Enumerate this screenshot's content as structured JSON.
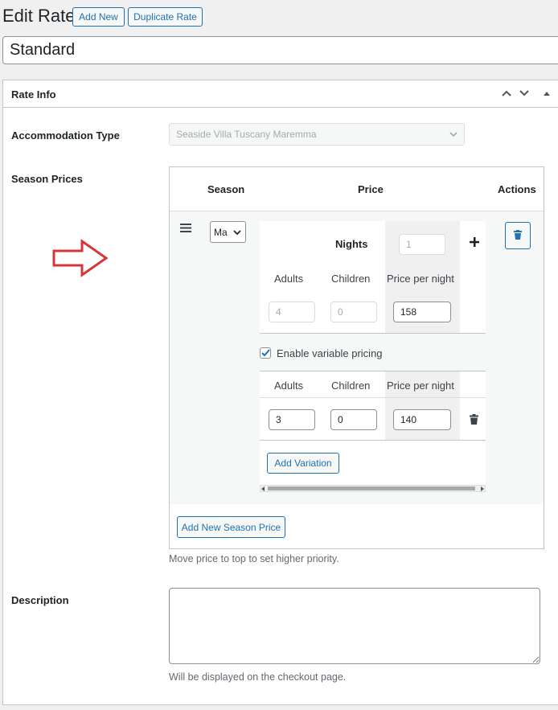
{
  "header": {
    "title": "Edit Rate",
    "add_new_label": "Add New",
    "duplicate_label": "Duplicate Rate",
    "rate_title_value": "Standard"
  },
  "rate_info": {
    "title": "Rate Info",
    "accommodation_label": "Accommodation Type",
    "accommodation_value": "Seaside Villa Tuscany Maremma",
    "season_prices_label": "Season Prices",
    "table": {
      "col_season": "Season",
      "col_price": "Price",
      "col_actions": "Actions",
      "season_value": "Ma",
      "nights_label": "Nights",
      "nights_value": "1",
      "adults_label": "Adults",
      "children_label": "Children",
      "price_per_night_label": "Price per night",
      "base_adults": "4",
      "base_children": "0",
      "base_price": "158",
      "enable_variable_label": "Enable variable pricing",
      "enable_variable_checked": true,
      "variation": {
        "adults": "3",
        "children": "0",
        "price": "140"
      },
      "add_variation_label": "Add Variation"
    },
    "add_season_price_label": "Add New Season Price",
    "priority_hint": "Move price to top to set higher priority.",
    "description_label": "Description",
    "description_value": "",
    "description_hint": "Will be displayed on the checkout page."
  },
  "icons": {
    "arrow_color": "#d63638",
    "accent": "#2271b1"
  }
}
